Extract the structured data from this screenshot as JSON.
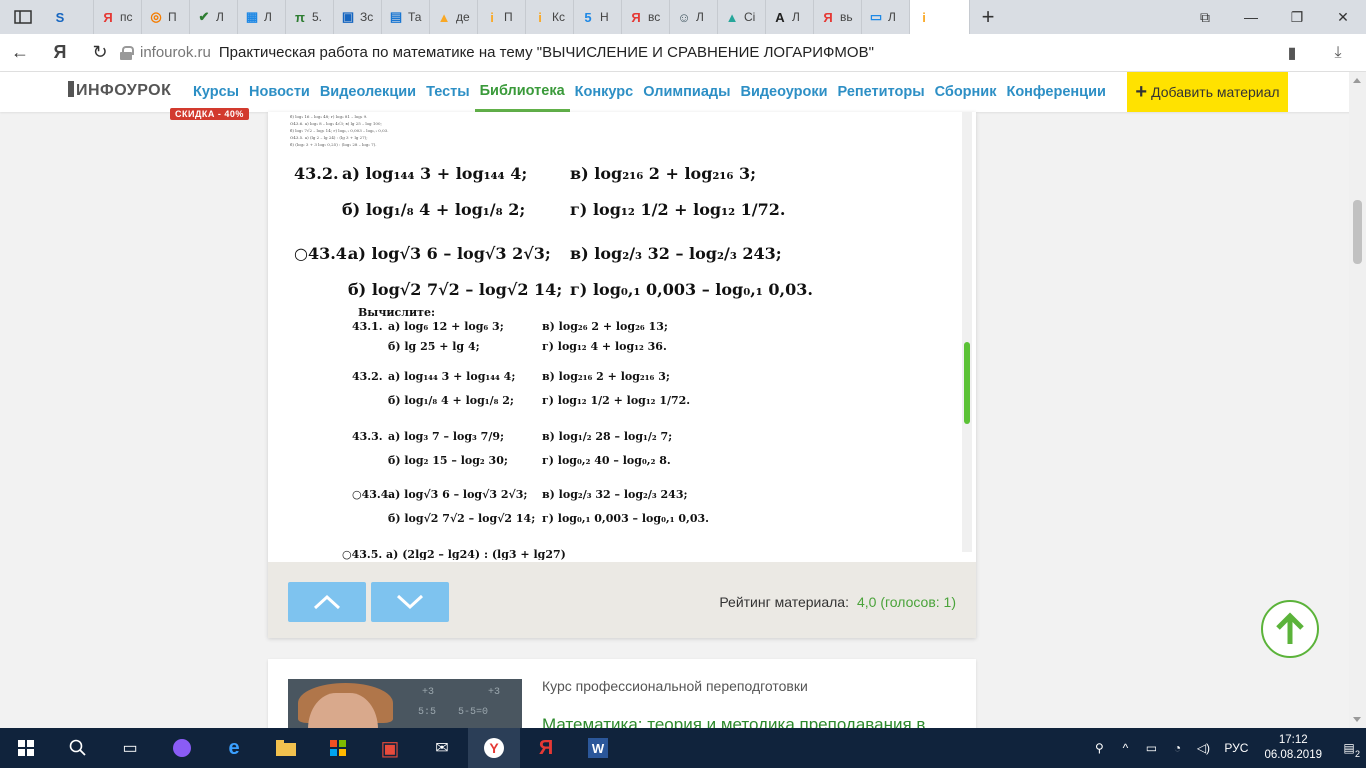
{
  "browser": {
    "tabs": [
      {
        "icon": "s-icon",
        "glyph": "S",
        "color": "#1565c0",
        "label": ""
      },
      {
        "icon": "yandex-icon",
        "glyph": "Я",
        "color": "#e53935",
        "label": "пс"
      },
      {
        "icon": "headset-icon",
        "glyph": "◎",
        "color": "#f57c00",
        "label": "П"
      },
      {
        "icon": "check-icon",
        "glyph": "✔",
        "color": "#2e7d32",
        "label": "Л"
      },
      {
        "icon": "grid-icon",
        "glyph": "▦",
        "color": "#1e88e5",
        "label": "Л"
      },
      {
        "icon": "pi-icon",
        "glyph": "π",
        "color": "#2e7d32",
        "label": "5."
      },
      {
        "icon": "ege-icon",
        "glyph": "▣",
        "color": "#1565c0",
        "label": "Зс"
      },
      {
        "icon": "book-icon",
        "glyph": "▤",
        "color": "#1976d2",
        "label": "Та"
      },
      {
        "icon": "picture-icon",
        "glyph": "▲",
        "color": "#f9a825",
        "label": "де"
      },
      {
        "icon": "infourok-icon",
        "glyph": "i",
        "color": "#f9a825",
        "label": "П"
      },
      {
        "icon": "infourok-icon",
        "glyph": "i",
        "color": "#f9a825",
        "label": "Кс"
      },
      {
        "icon": "five-icon",
        "glyph": "5",
        "color": "#1e88e5",
        "label": "Н"
      },
      {
        "icon": "yandex-icon",
        "glyph": "Я",
        "color": "#e53935",
        "label": "вс"
      },
      {
        "icon": "person-icon",
        "glyph": "☺",
        "color": "#455a64",
        "label": "Л"
      },
      {
        "icon": "cap-icon",
        "glyph": "▲",
        "color": "#26a69a",
        "label": "Сі"
      },
      {
        "icon": "letter-a-icon",
        "glyph": "A",
        "color": "#212121",
        "label": "Л"
      },
      {
        "icon": "yandex-icon",
        "glyph": "Я",
        "color": "#e53935",
        "label": "вь"
      },
      {
        "icon": "presentation-icon",
        "glyph": "▭",
        "color": "#1e88e5",
        "label": "Л"
      },
      {
        "icon": "infourok-icon",
        "glyph": "i",
        "color": "#f9a825",
        "label": ""
      }
    ],
    "address": {
      "domain": "infourok.ru",
      "title": "Практическая работа по математике на тему \"ВЫЧИСЛЕНИЕ И СРАВНЕНИЕ ЛОГАРИФМОВ\""
    }
  },
  "site": {
    "logo": "ИНФОУРОК",
    "sale_badge": "СКИДКА - 40%",
    "nav": [
      "Курсы",
      "Новости",
      "Видеолекции",
      "Тесты",
      "Библиотека",
      "Конкурс",
      "Олимпиады",
      "Видеоуроки",
      "Репетиторы",
      "Сборник",
      "Конференции"
    ],
    "active_nav": "Библиотека",
    "add_material": "Добавить материал"
  },
  "doc": {
    "thumb_lines": [
      "б) log₃ 16 – log₃ 48;      г) log₃ 81 – log₃ 9.",
      "О43.6. а) log₃ 8 – log₃ 4√3;     в) lg 25 – log 100;",
      "б) log₂ 7√2 – log₂ 14;     г) log₀,₁ 0,003 – log₀,₁ 0,03.",
      "О43.5. а) (lg 2 – lg 24) : (lg 3 + lg 27);",
      "б) (log₂ 3 + 3 log₂ 0,25) : (log₂ 28 – log₂ 7)."
    ],
    "big_rows": [
      {
        "num": "43.2.",
        "a": "а) log₁₄₄ 3 + log₁₄₄ 4;",
        "b": "в) log₂₁₆ 2 + log₂₁₆ 3;"
      },
      {
        "num": "",
        "a": "б) log₁/₈ 4 + log₁/₈ 2;",
        "b": "г) log₁₂ 1/2 + log₁₂ 1/72."
      },
      {
        "num": "○43.4.",
        "a": "а) log√3 6 – log√3 2√3;",
        "b": "в) log₂/₃ 32 – log₂/₃ 243;"
      },
      {
        "num": "",
        "a": "б) log√2 7√2 – log√2 14;",
        "b": "г) log₀,₁ 0,003 – log₀,₁ 0,03."
      }
    ],
    "heading": "Вычислите:",
    "small_rows": [
      {
        "num": "43.1.",
        "a": "а) log₆ 12 + log₆ 3;",
        "b": "в) log₂₆ 2 + log₂₆ 13;"
      },
      {
        "num": "",
        "a": "б) lg 25 + lg 4;",
        "b": "г) log₁₂ 4 + log₁₂ 36."
      },
      {
        "num": "43.2.",
        "a": "а) log₁₄₄ 3 + log₁₄₄ 4;",
        "b": "в) log₂₁₆ 2 + log₂₁₆ 3;"
      },
      {
        "num": "",
        "a": "б) log₁/₈ 4 + log₁/₈ 2;",
        "b": "г) log₁₂ 1/2 + log₁₂ 1/72."
      },
      {
        "num": "43.3.",
        "a": "а) log₃ 7 – log₃ 7/9;",
        "b": "в) log₁/₂ 28 – log₁/₂ 7;"
      },
      {
        "num": "",
        "a": "б) log₂ 15 – log₂ 30;",
        "b": "г) log₀,₂ 40 – log₀,₂ 8."
      },
      {
        "num": "○43.4.",
        "a": "а) log√3 6 – log√3 2√3;",
        "b": "в) log₂/₃ 32 – log₂/₃ 243;"
      },
      {
        "num": "",
        "a": "б) log√2 7√2 – log√2 14;",
        "b": "г) log₀,₁ 0,003 – log₀,₁ 0,03."
      }
    ],
    "cut_line": "○43.5. а) (2lg2 – lg24) : (lg3 + lg27)"
  },
  "viewer": {
    "rating_label": "Рейтинг материала:",
    "rating_value": "4,0 (голосов: 1)"
  },
  "course": {
    "type": "Курс профессиональной переподготовки",
    "title": "Математика: теория и методика преподавания в",
    "board_text": [
      "+3",
      "5-5=0",
      "+3",
      "5:5"
    ]
  },
  "taskbar": {
    "lang": "РУС",
    "time": "17:12",
    "date": "06.08.2019",
    "notifications": "2"
  },
  "colors": {
    "accent_blue": "#2d8fc5",
    "accent_green": "#5bb33a",
    "add_material_bg": "#ffe200",
    "button_blue": "#7ec3ef"
  }
}
